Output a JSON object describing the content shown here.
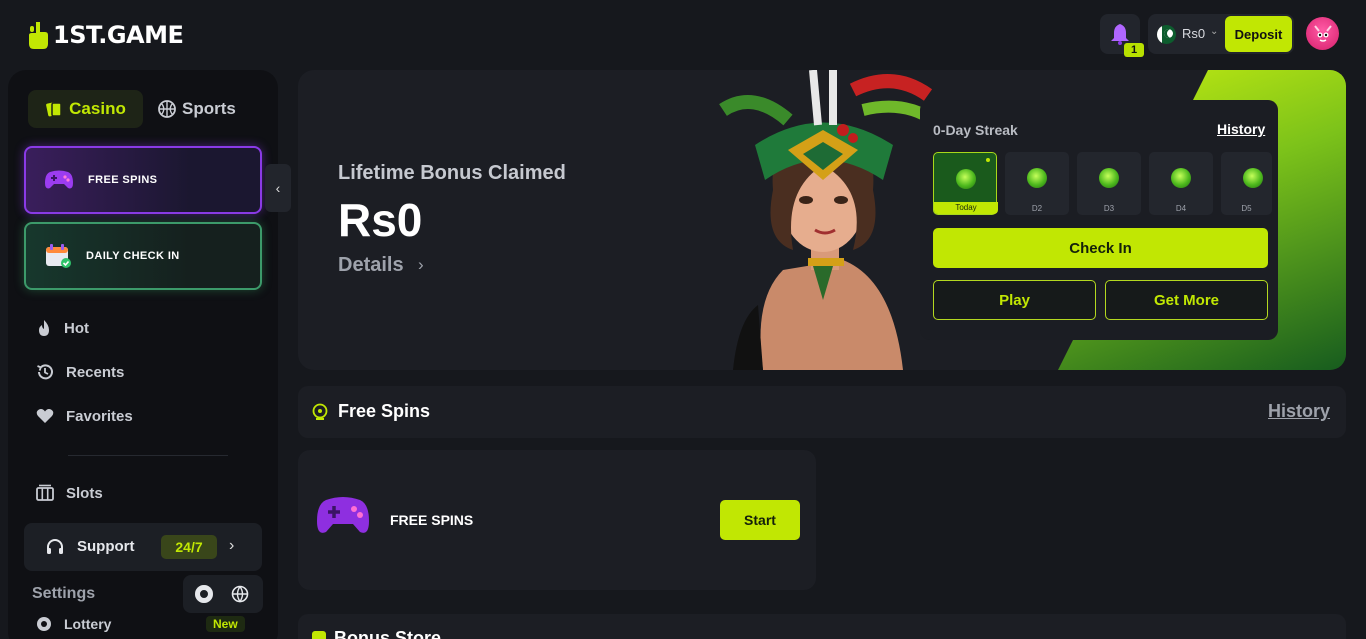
{
  "brand": {
    "name": "1ST.GAME"
  },
  "header": {
    "notifications_count": "1",
    "balance": "Rs0",
    "deposit_label": "Deposit"
  },
  "sidebar": {
    "tabs": [
      {
        "label": "Casino",
        "active": true
      },
      {
        "label": "Sports",
        "active": false
      }
    ],
    "promos": [
      {
        "label": "FREE SPINS"
      },
      {
        "label": "DAILY CHECK IN"
      }
    ],
    "items": [
      {
        "label": "Hot",
        "icon": "fire-icon"
      },
      {
        "label": "Recents",
        "icon": "history-icon"
      },
      {
        "label": "Favorites",
        "icon": "heart-icon"
      },
      {
        "label": "Slots",
        "icon": "slots-icon"
      }
    ],
    "support": {
      "label": "Support",
      "badge": "24/7"
    },
    "settings_label": "Settings",
    "lottery": {
      "label": "Lottery",
      "badge": "New"
    }
  },
  "hero": {
    "subtitle": "Lifetime Bonus Claimed",
    "amount": "Rs0",
    "details_label": "Details",
    "streak": {
      "title": "0-Day Streak",
      "history_label": "History",
      "days": [
        "Today",
        "D2",
        "D3",
        "D4",
        "D5"
      ],
      "checkin_label": "Check In",
      "play_label": "Play",
      "get_more_label": "Get More"
    }
  },
  "free_spins": {
    "title": "Free Spins",
    "history_label": "History",
    "card_label": "FREE SPINS",
    "start_label": "Start"
  },
  "bonus_store": {
    "title": "Bonus Store"
  },
  "colors": {
    "accent": "#c1e703",
    "background": "#16181d",
    "panel": "#1c1e24"
  }
}
